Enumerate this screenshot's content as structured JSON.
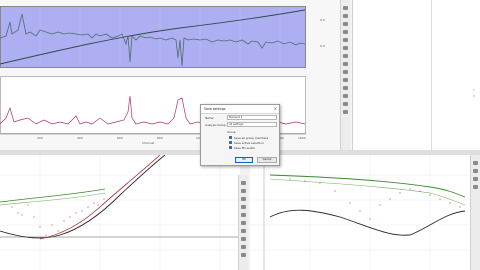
{
  "colors": {
    "top_plot_bg": "#aeaef2",
    "signal_line": "#4f6d6f",
    "trend_line": "#2e4a4c",
    "bottom_signal": "#b03070",
    "fit_green": "#3b8a2e",
    "fit_red": "#b02828",
    "fit_dark": "#2b2b2b",
    "scatter_red": "#d05050",
    "accent_blue": "#1e6fd9"
  },
  "toolbar_icons": [
    "zoom-in-icon",
    "zoom-out-icon",
    "pan-icon",
    "cursor-icon",
    "settings-icon"
  ],
  "top_chart": {
    "right_axis_ticks": [
      "0.5",
      "0.0"
    ],
    "x_ticks": [
      "200",
      "400",
      "600",
      "800",
      "1000",
      "1200",
      "1400",
      "1600"
    ],
    "x_label": "Channel"
  },
  "dialog": {
    "title": "Save settings",
    "name_label": "Name:",
    "name_value": "Element 1",
    "group_label": "Analysis Group:",
    "group_value": "All settings",
    "section_label": "Group",
    "options": [
      {
        "label": "Save all group members",
        "checked": true
      },
      {
        "label": "Save active selection",
        "checked": true
      },
      {
        "label": "Save fit results",
        "checked": true
      }
    ],
    "ok_label": "OK",
    "cancel_label": "Cancel"
  },
  "right_panel": {
    "note_a": "1",
    "note_b": "0"
  }
}
